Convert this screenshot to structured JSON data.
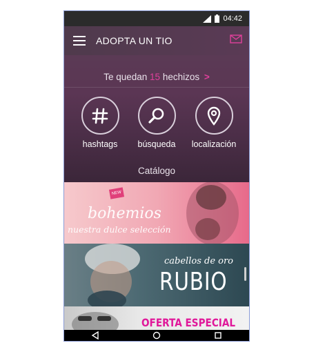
{
  "status_bar": {
    "time": "04:42"
  },
  "app_bar": {
    "title": "ADOPTA UN TIO",
    "menu_icon": "hamburger-icon",
    "mail_icon": "mail-icon"
  },
  "hechizos": {
    "prefix": "Te quedan",
    "count": "15",
    "suffix": "hechizos",
    "arrow": ">"
  },
  "actions": [
    {
      "label": "hashtags",
      "icon": "hashtag-icon"
    },
    {
      "label": "búsqueda",
      "icon": "search-icon"
    },
    {
      "label": "localización",
      "icon": "location-pin-icon"
    }
  ],
  "catalogo": {
    "title": "Catálogo"
  },
  "banners": [
    {
      "badge": "NEW",
      "title": "bohemios",
      "subtitle": "nuestra dulce selección"
    },
    {
      "script": "cabellos de oro",
      "title": "RUBIO"
    },
    {
      "title": "OFERTA ESPECIAL"
    }
  ],
  "colors": {
    "accent": "#e0409b",
    "appbar": "#4f3a4c"
  }
}
